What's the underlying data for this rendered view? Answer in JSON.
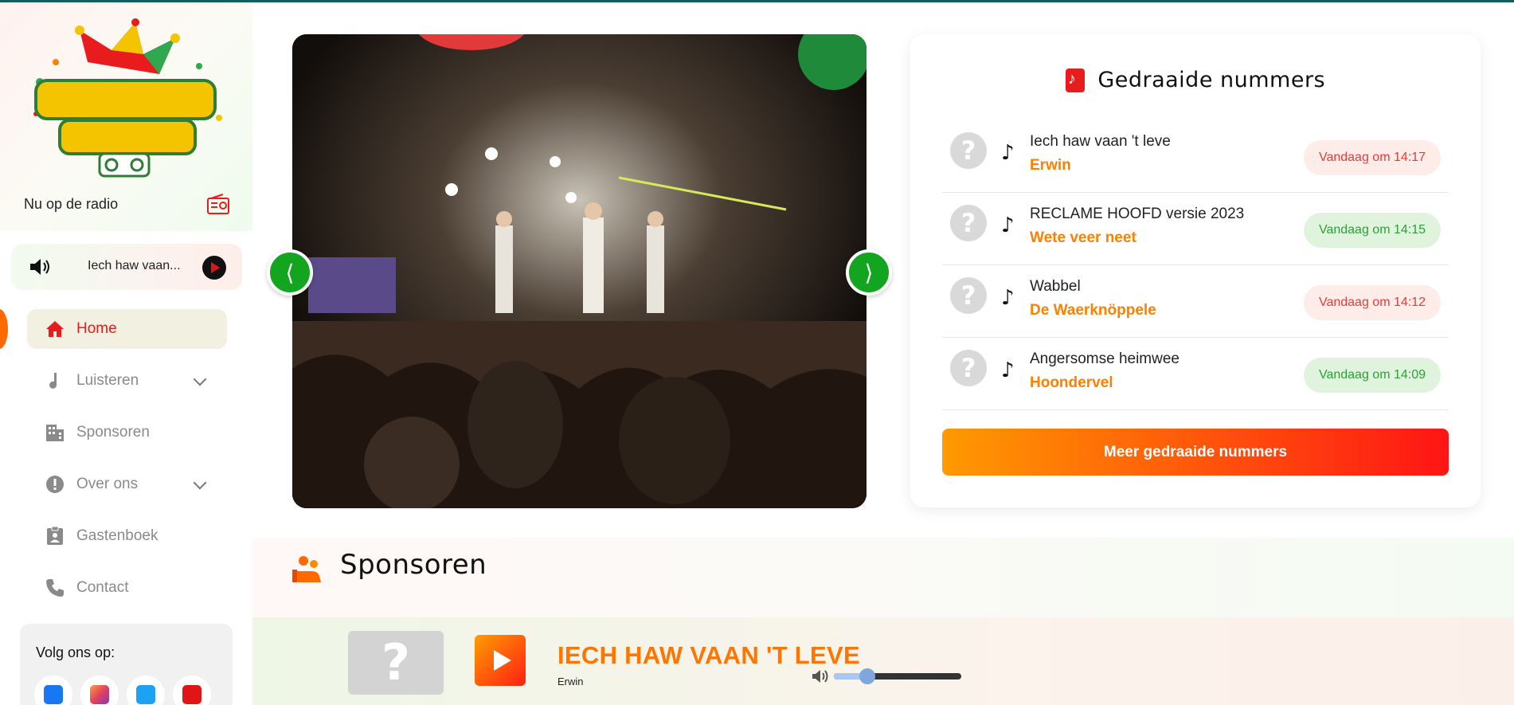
{
  "sidebar": {
    "logo_alt": "CarnavalRadio.nl",
    "now_on_radio": "Nu op de radio",
    "mini_player": {
      "title": "Iech haw vaan..."
    },
    "nav": [
      {
        "label": "Home",
        "icon": "home-icon",
        "active": true
      },
      {
        "label": "Luisteren",
        "icon": "music-note-icon",
        "has_submenu": true
      },
      {
        "label": "Sponsoren",
        "icon": "building-icon"
      },
      {
        "label": "Over ons",
        "icon": "info-icon",
        "has_submenu": true
      },
      {
        "label": "Gastenboek",
        "icon": "guestbook-icon"
      },
      {
        "label": "Contact",
        "icon": "phone-icon"
      }
    ],
    "follow": {
      "label": "Volg ons op:",
      "socials": [
        "facebook-icon",
        "instagram-icon",
        "twitter-icon",
        "youtube-icon"
      ]
    }
  },
  "played": {
    "title": "Gedraaide nummers",
    "tracks": [
      {
        "song": "Iech haw vaan 't leve",
        "artist": "Erwin",
        "time": "Vandaag om 14:17",
        "time_color": "red"
      },
      {
        "song": "RECLAME HOOFD versie 2023",
        "artist": "Wete veer neet",
        "time": "Vandaag om 14:15",
        "time_color": "green"
      },
      {
        "song": "Wabbel",
        "artist": "De Waerknöppele",
        "time": "Vandaag om 14:12",
        "time_color": "red"
      },
      {
        "song": "Angersomse heimwee",
        "artist": "Hoondervel",
        "time": "Vandaag om 14:09",
        "time_color": "green"
      }
    ],
    "more_button": "Meer gedraaide nummers"
  },
  "sponsors": {
    "title": "Sponsoren"
  },
  "player": {
    "song": "IECH HAW VAAN 'T LEVE",
    "artist": "Erwin",
    "volume": 0.26
  },
  "colors": {
    "accent_orange": "#ff7f00",
    "accent_red": "#e81c1c",
    "slider_arrow_green": "#13a51f"
  }
}
